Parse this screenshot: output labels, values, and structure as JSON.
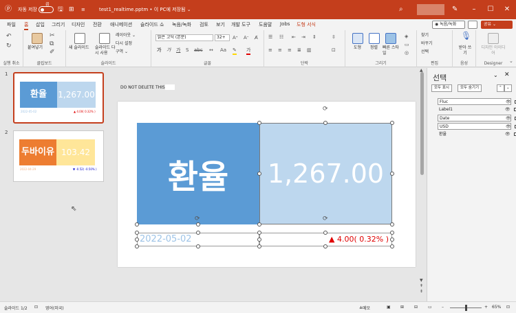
{
  "titlebar": {
    "autosave_label": "자동 저장",
    "autosave_state": "끔",
    "filename": "test1_realtime.pptm • 이 PC에 저장됨 ⌄"
  },
  "tabs": [
    "파일",
    "홈",
    "삽입",
    "그리기",
    "디자인",
    "전환",
    "애니메이션",
    "슬라이드 쇼",
    "녹음/녹화",
    "검토",
    "보기",
    "개발 도구",
    "도움말",
    "Jobs",
    "도형 서식"
  ],
  "tabs_right": {
    "record": "◉ 녹음/녹화",
    "share": "공유 ⌄"
  },
  "ribbon": {
    "groups": {
      "undo": "실행 취소",
      "clipboard": "클립보드",
      "slides": "슬라이드",
      "font": "글꼴",
      "paragraph": "단락",
      "drawing": "그리기",
      "editing": "편집",
      "voice": "음성",
      "designer": "Designer"
    },
    "paste": "붙여넣기",
    "new_slide": "새 슬라이드",
    "reuse_slide": "슬라이드 다시 사용",
    "layout": "레이아웃 ⌄",
    "reset": "다시 설정",
    "section": "구역 ⌄",
    "font_name": "맑은 고딕 (본문)",
    "font_size": "32+",
    "shape": "도형",
    "arrange": "정렬",
    "quick_styles": "빠른 스타일",
    "find": "찾기",
    "replace": "바꾸기",
    "select": "선택",
    "dictate": "받아 쓰기",
    "designer_btn": "디자인 아이디어"
  },
  "thumbnails": [
    {
      "num": "1",
      "left_text": "환율",
      "right_text": "1,267.00",
      "date": "2022-05-02",
      "change": "▲ 4.00( 0.32% )",
      "left_color": "#5b9bd5",
      "right_color": "#bdd7ee"
    },
    {
      "num": "2",
      "left_text": "두바이유",
      "right_text": "103.42",
      "date": "2022-04-29",
      "change": "▼ -0.52( -0.50% )",
      "left_color": "#ed7d31",
      "right_color": "#ffe699"
    }
  ],
  "slide": {
    "note": "DO NOT DELETE THIS",
    "label": "환율",
    "value": "1,267.00",
    "date": "2022-05-02",
    "change": "▲ 4.00( 0.32% )"
  },
  "selection_pane": {
    "title": "선택",
    "show_all": "모두 표시",
    "hide_all": "모두 숨기기",
    "items": [
      "Fluc",
      "Label1",
      "Date",
      "USD",
      "환율"
    ]
  },
  "statusbar": {
    "slide_info": "슬라이드 1/2",
    "language": "영어(미국)",
    "notes": "≜메모",
    "zoom": "65%"
  },
  "colors": {
    "accent": "#c43e1c",
    "label_box": "#5b9bd5",
    "value_box": "#bdd7ee",
    "date_text": "#9dc3e6",
    "change_text": "#e00000"
  }
}
